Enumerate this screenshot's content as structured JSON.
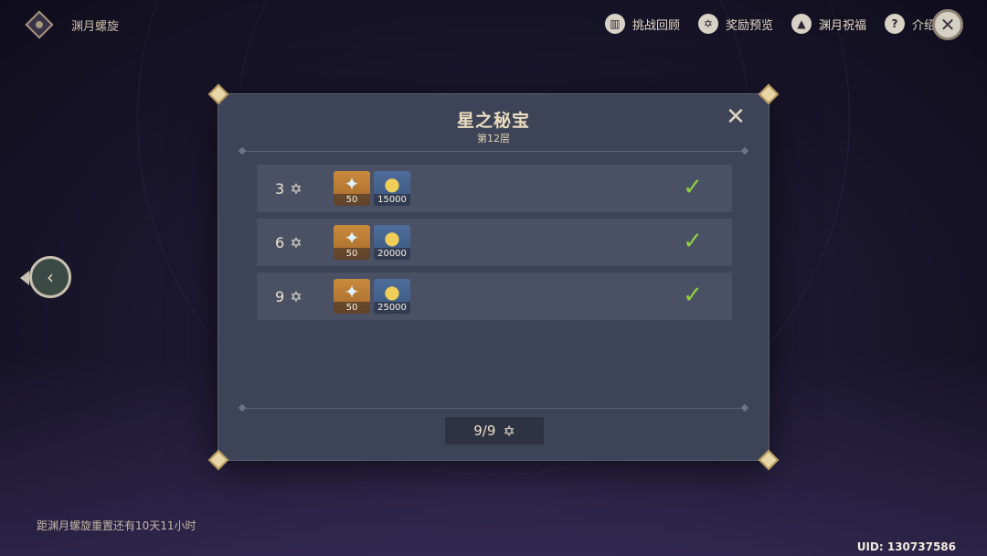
{
  "header": {
    "title": "渊月螺旋",
    "menu": [
      {
        "label": "挑战回顾",
        "icon": "book-icon"
      },
      {
        "label": "奖励预览",
        "icon": "star-badge-icon"
      },
      {
        "label": "渊月祝福",
        "icon": "upload-icon"
      },
      {
        "label": "介绍",
        "icon": "question-icon"
      }
    ],
    "close_icon": "close-icon"
  },
  "modal": {
    "title": "星之秘宝",
    "subtitle": "第12层",
    "rows": [
      {
        "stars": "3",
        "gem_qty": "50",
        "coin_qty": "15000",
        "claimed": true
      },
      {
        "stars": "6",
        "gem_qty": "50",
        "coin_qty": "20000",
        "claimed": true
      },
      {
        "stars": "9",
        "gem_qty": "50",
        "coin_qty": "25000",
        "claimed": true
      }
    ],
    "total": "9/9"
  },
  "footer": {
    "reset_text": "距渊月螺旋重置还有10天11小时",
    "uid": "UID: 130737586"
  },
  "colors": {
    "modal_bg": "#3d4457",
    "row_bg": "#4a5165",
    "check": "#8fd045",
    "gem_bg": "#c98a3e",
    "coin_bg": "#4e6d9a"
  }
}
